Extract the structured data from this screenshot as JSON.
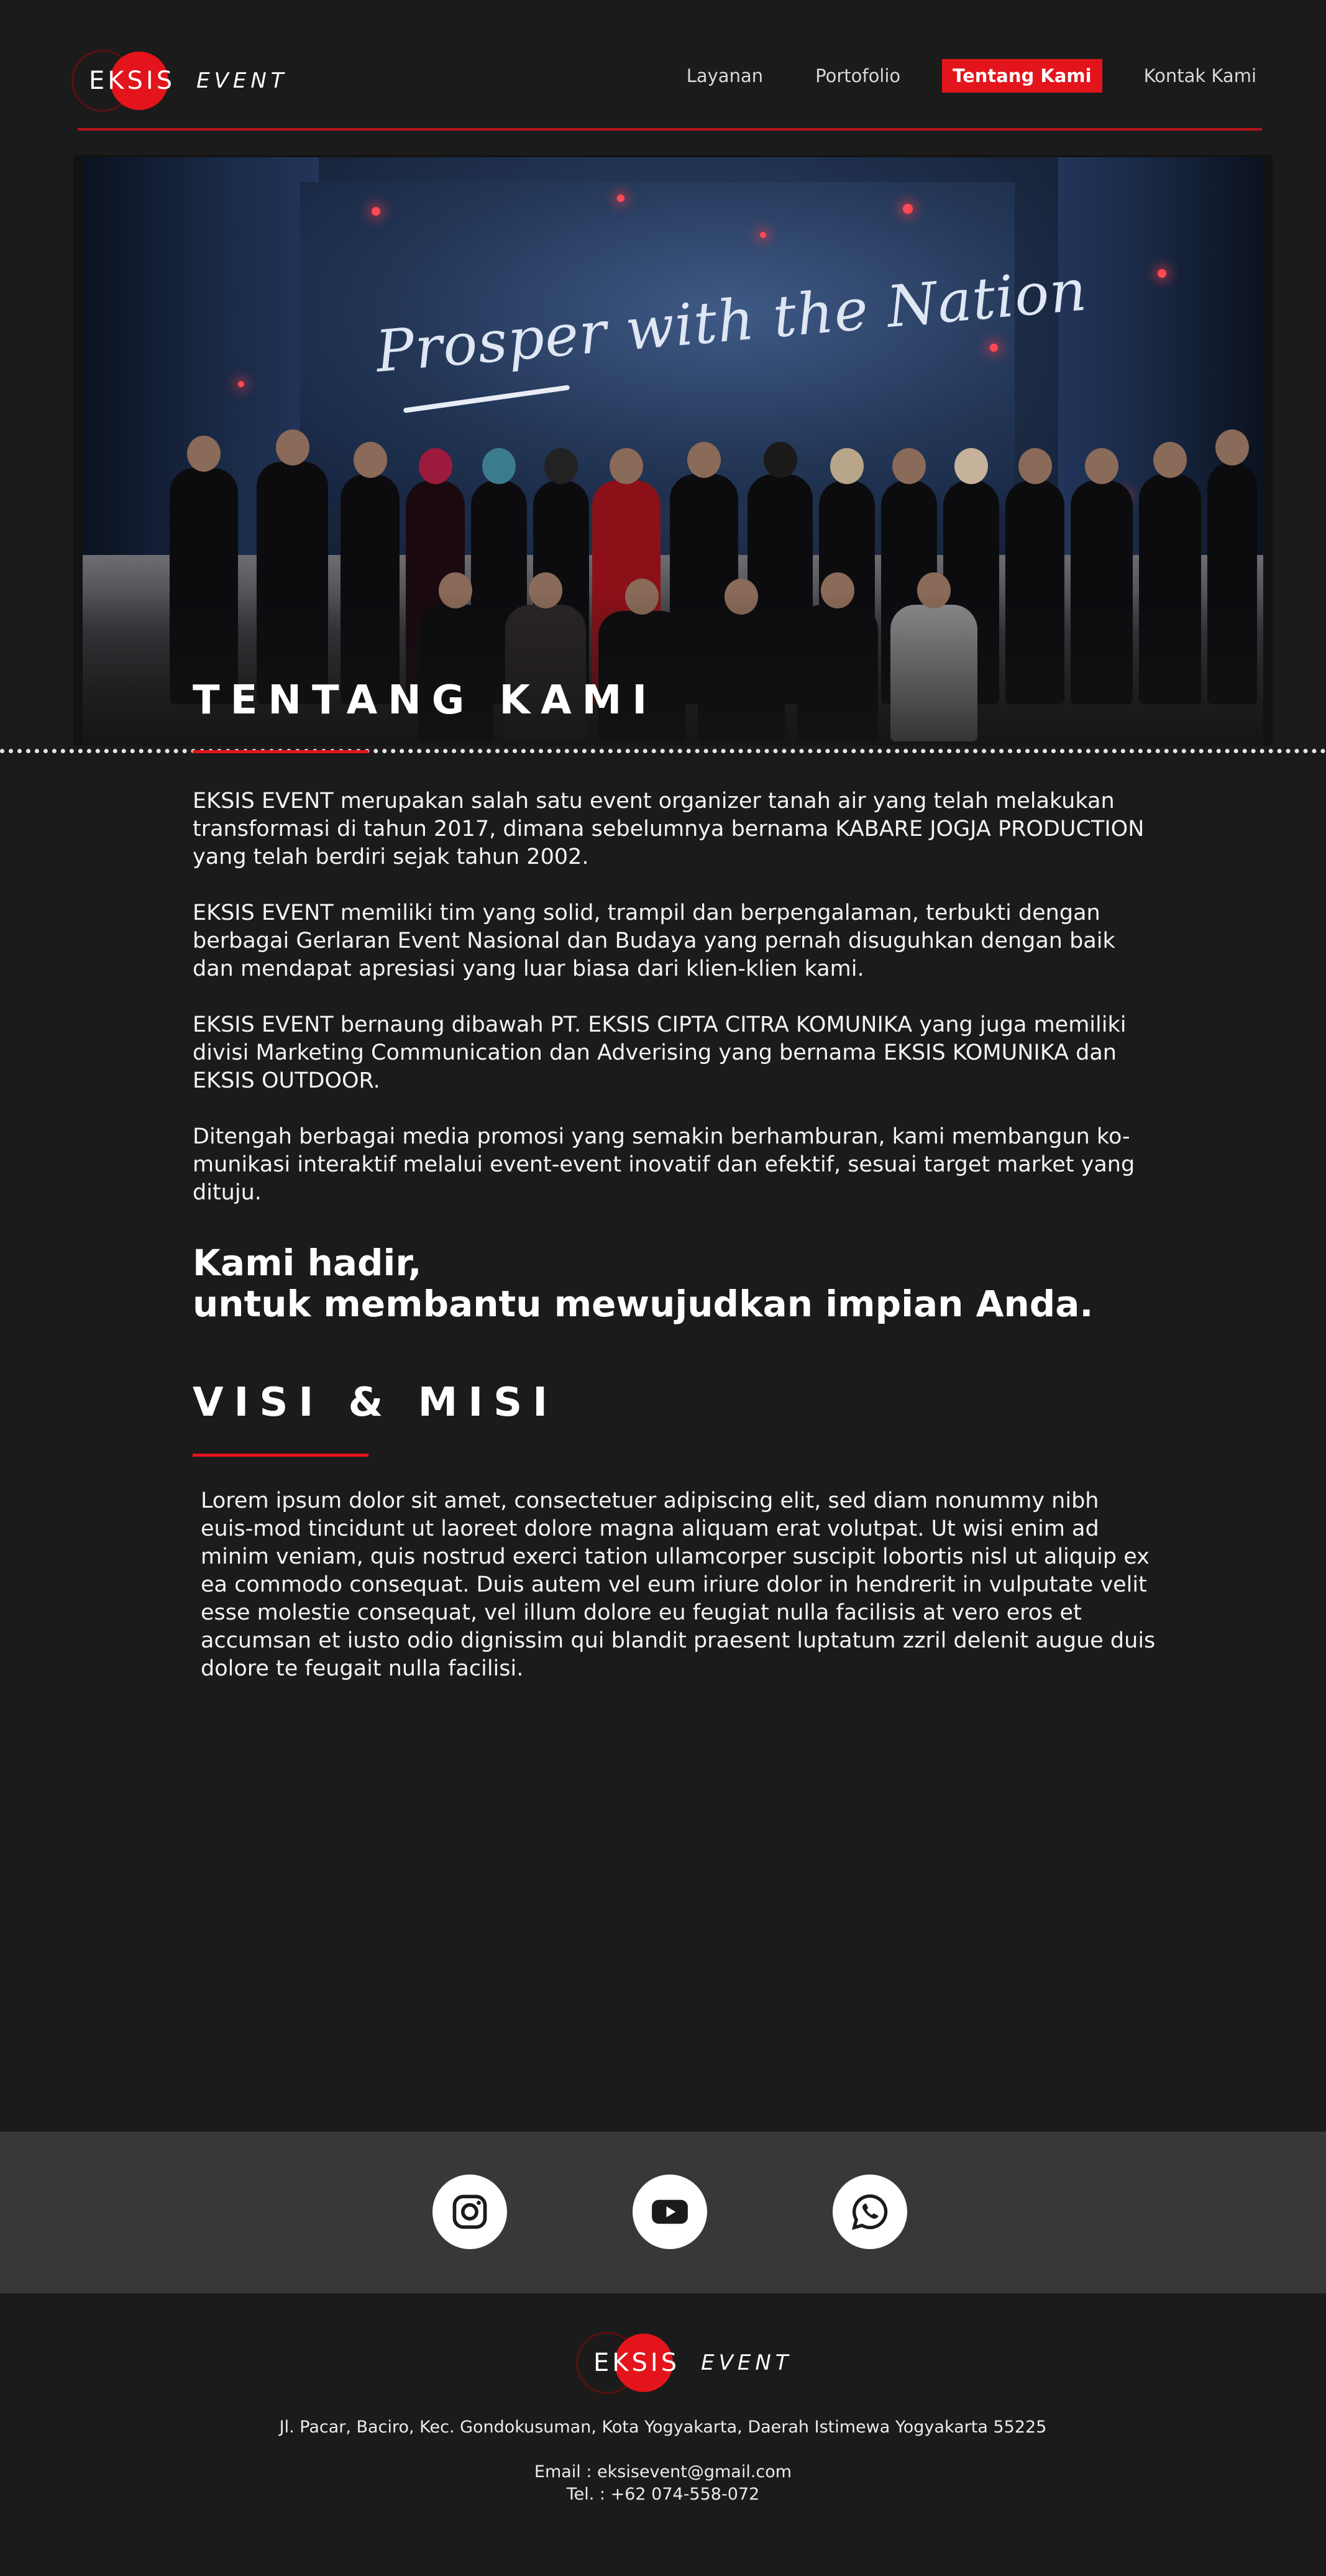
{
  "brand": {
    "name": "EKSIS",
    "sub": "EVENT",
    "accent": "#e3141b",
    "background": "#1b1b1c"
  },
  "nav": {
    "items": [
      {
        "label": "Layanan"
      },
      {
        "label": "Portofolio"
      },
      {
        "label": "Tentang Kami",
        "active": true
      },
      {
        "label": "Kontak Kami"
      }
    ]
  },
  "hero": {
    "banner_text": "Prosper with the Nation",
    "title": "TENTANG KAMI"
  },
  "about": {
    "paragraphs": [
      "EKSIS EVENT merupakan salah satu event organizer tanah air yang telah melakukan transformasi di tahun 2017, dimana sebelumnya bernama KABARE JOGJA PRODUCTION yang telah berdiri sejak tahun 2002.",
      "EKSIS EVENT memiliki tim yang solid, trampil dan berpengalaman, terbukti dengan berbagai Gerlaran Event Nasional dan Budaya yang pernah disuguhkan dengan baik dan mendapat apresiasi yang luar biasa dari klien-klien kami.",
      "EKSIS EVENT bernaung dibawah PT. EKSIS CIPTA CITRA KOMUNIKA yang  juga memiliki divisi Marketing Communication dan Adverising yang bernama EKSIS KOMUNIKA dan EKSIS OUTDOOR.",
      "Ditengah berbagai media promosi yang semakin berhamburan, kami membangun ko-munikasi interaktif melalui event-event inovatif dan efektif, sesuai target market yang dituju."
    ],
    "tagline_1": "Kami hadir,",
    "tagline_2": "untuk membantu mewujudkan impian Anda."
  },
  "vision": {
    "title": "VISI & MISI",
    "text": "Lorem ipsum dolor sit amet, consectetuer adipiscing elit, sed diam nonummy nibh euis-mod tincidunt ut laoreet dolore magna aliquam erat volutpat. Ut wisi enim ad minim veniam, quis nostrud exerci tation ullamcorper suscipit lobortis nisl ut aliquip ex ea commodo consequat. Duis autem vel eum iriure dolor in hendrerit in vulputate velit esse molestie consequat, vel illum dolore eu feugiat nulla facilisis at vero eros et accumsan et iusto odio dignissim qui blandit praesent luptatum zzril delenit augue duis dolore te feugait nulla facilisi."
  },
  "social": [
    {
      "icon": "instagram-icon"
    },
    {
      "icon": "youtube-icon"
    },
    {
      "icon": "whatsapp-icon"
    }
  ],
  "footer": {
    "address": "Jl. Pacar, Baciro, Kec. Gondokusuman, Kota Yogyakarta, Daerah Istimewa Yogyakarta 55225",
    "email": "Email : eksisevent@gmail.com",
    "phone": "Tel. : +62 074-558-072"
  }
}
